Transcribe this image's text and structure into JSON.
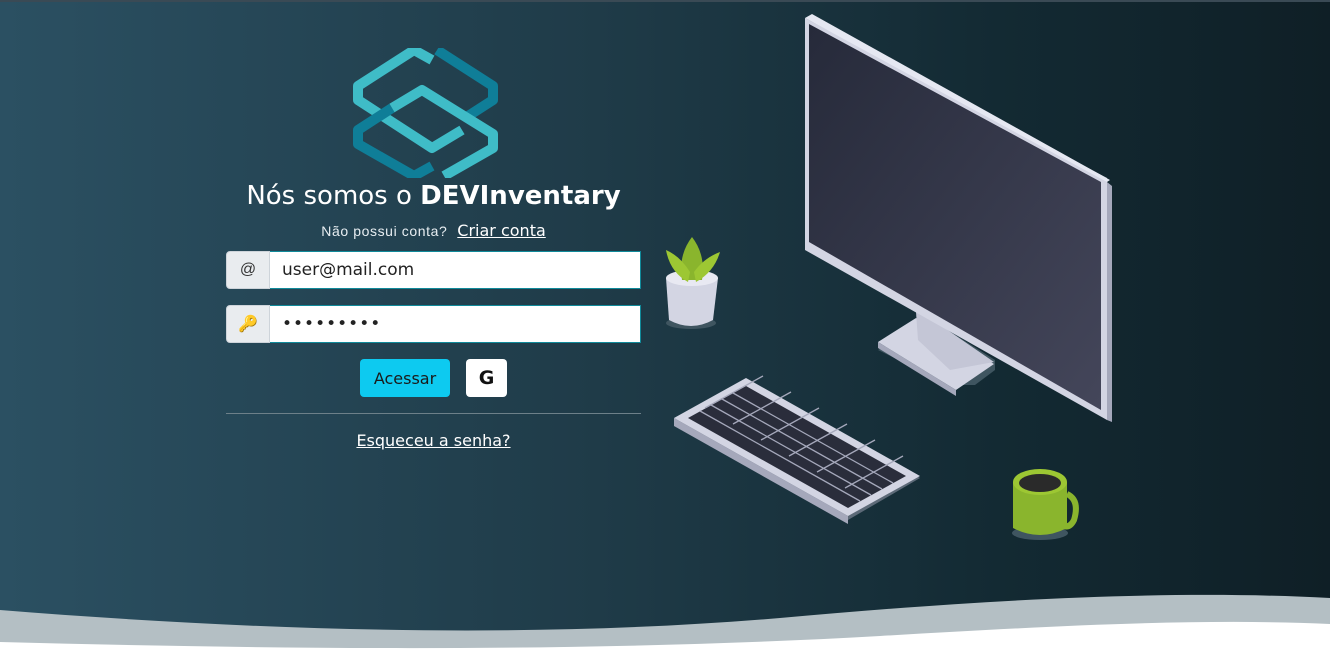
{
  "header": {
    "title_prefix": "Nós somos o ",
    "title_brand": "DEVInventary"
  },
  "signup": {
    "question": "Não possui conta?",
    "link_label": "Criar conta"
  },
  "email_field": {
    "addon": "@",
    "value": "user@mail.com",
    "placeholder": "",
    "icon": "at-sign-icon"
  },
  "password_field": {
    "addon": "🔑",
    "value": "•••••••••",
    "icon": "key-icon"
  },
  "buttons": {
    "login_label": "Acessar",
    "google_label": "G"
  },
  "forgot_link": "Esqueceu a senha?",
  "colors": {
    "accent": "#0dcaf0",
    "logo_light": "#3fbcc7",
    "logo_dark": "#0f7e98",
    "background_left": "#2b5062",
    "background_right": "#0f1f26"
  },
  "illustration": {
    "items": [
      "monitor-icon",
      "keyboard-icon",
      "plant-icon",
      "mug-icon"
    ]
  }
}
